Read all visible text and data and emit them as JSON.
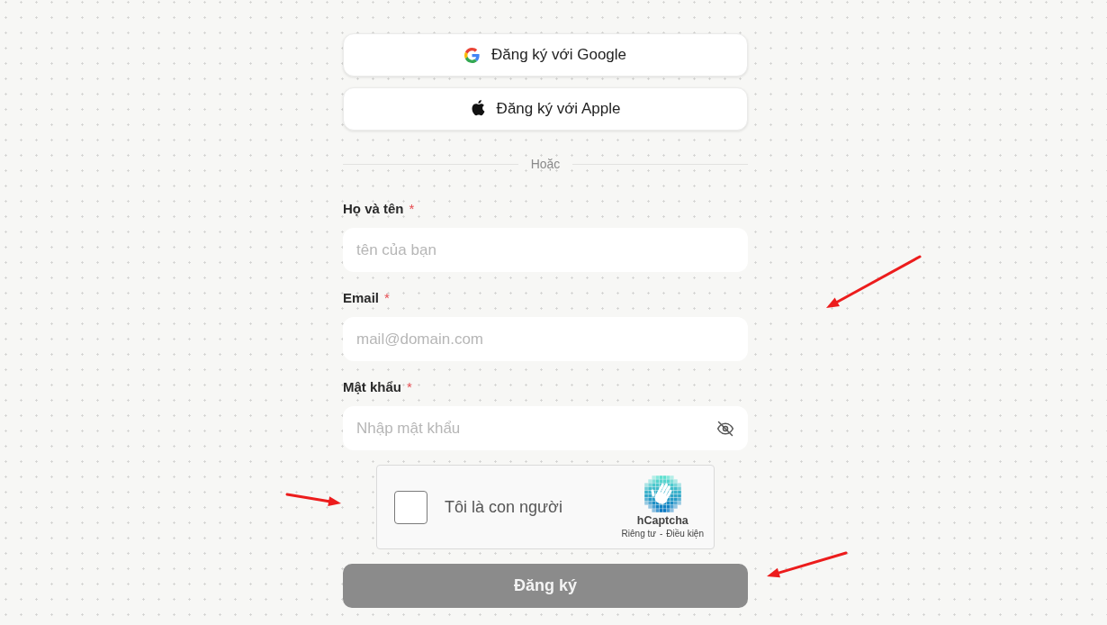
{
  "social_buttons": [
    {
      "kind": "google",
      "label": "Đăng ký với Google"
    },
    {
      "kind": "apple",
      "label": "Đăng ký với Apple"
    }
  ],
  "divider": {
    "label": "Hoặc"
  },
  "fields": [
    {
      "kind": "text",
      "label": "Họ và tên",
      "required_mark": "*",
      "placeholder": "tên của bạn"
    },
    {
      "kind": "email",
      "label": "Email",
      "required_mark": "*",
      "placeholder": "mail@domain.com"
    },
    {
      "kind": "password",
      "label": "Mật khẩu",
      "required_mark": "*",
      "placeholder": "Nhập mật khẩu",
      "password_visible": false
    }
  ],
  "captcha": {
    "label": "Tôi là con người",
    "checked": false,
    "brand": "hCaptcha",
    "links": [
      "Riêng tư",
      "Điều kiện"
    ],
    "separator": "-"
  },
  "submit": {
    "label": "Đăng ký",
    "disabled": true
  },
  "annotations": [
    {
      "kind": "arrow"
    },
    {
      "kind": "arrow"
    },
    {
      "kind": "arrow"
    }
  ]
}
